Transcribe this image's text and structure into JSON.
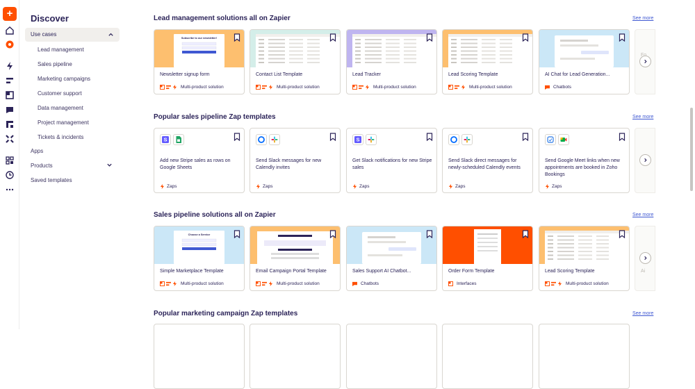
{
  "sidebar": {
    "title": "Discover",
    "use_cases": "Use cases",
    "sub_items": [
      "Lead management",
      "Sales pipeline",
      "Marketing campaigns",
      "Customer support",
      "Data management",
      "Project management",
      "Tickets & incidents"
    ],
    "apps": "Apps",
    "products": "Products",
    "saved": "Saved templates"
  },
  "rail_icons": [
    "create-plus-icon",
    "home-icon",
    "discover-icon",
    "zaps-icon",
    "tables-icon",
    "interfaces-icon",
    "chatbots-icon",
    "canvas-icon",
    "agents-icon",
    "app-connections-icon",
    "history-icon",
    "more-icon"
  ],
  "colors": {
    "brand": "#ff4f00",
    "link": "#3f58d2",
    "ink": "#2b2358"
  },
  "see_more": "See more",
  "sections": [
    {
      "title": "Lead management solutions all on Zapier",
      "cards": [
        {
          "title": "Newsletter signup form",
          "meta": "Multi-product solution",
          "thumb_bg": "#fdbf6f",
          "kind": "form",
          "thumb_text": "Subscribe to our newsletter!"
        },
        {
          "title": "Contact List Template",
          "meta": "Multi-product solution",
          "thumb_bg": "#d4eee9",
          "kind": "table"
        },
        {
          "title": "Lead Tracker",
          "meta": "Multi-product solution",
          "thumb_bg": "#bfb5f0",
          "kind": "table"
        },
        {
          "title": "Lead Scoring Template",
          "meta": "Multi-product solution",
          "thumb_bg": "#fdbf6f",
          "kind": "table"
        },
        {
          "title": "AI Chat for Lead Generation...",
          "meta": "Chatbots",
          "thumb_bg": "#cbe7f7",
          "kind": "chat"
        }
      ]
    },
    {
      "title": "Popular sales pipeline Zap templates",
      "zaps": [
        {
          "title": "Add new Stripe sales as rows on Google Sheets",
          "meta": "Zaps",
          "apps": [
            "stripe-icon",
            "google-sheets-icon"
          ]
        },
        {
          "title": "Send Slack messages for new Calendly invites",
          "meta": "Zaps",
          "apps": [
            "calendly-icon",
            "slack-icon"
          ]
        },
        {
          "title": "Get Slack notifications for new Stripe sales",
          "meta": "Zaps",
          "apps": [
            "stripe-icon",
            "slack-icon"
          ]
        },
        {
          "title": "Send Slack direct messages for newly-scheduled Calendly events",
          "meta": "Zaps",
          "apps": [
            "calendly-icon",
            "slack-icon"
          ]
        },
        {
          "title": "Send Google Meet links when new appointments are booked in Zoho Bookings",
          "meta": "Zaps",
          "apps": [
            "zoho-bookings-icon",
            "google-meet-icon"
          ]
        }
      ]
    },
    {
      "title": "Sales pipeline solutions all on Zapier",
      "cards": [
        {
          "title": "Simple Marketplace Template",
          "meta": "Multi-product solution",
          "thumb_bg": "#cbe7f7",
          "kind": "service",
          "thumb_text": "Choose a Service"
        },
        {
          "title": "Email Campaign Portal Template",
          "meta": "Multi-product solution",
          "thumb_bg": "#fdbf6f",
          "kind": "portal"
        },
        {
          "title": "Sales Support AI Chatbot...",
          "meta": "Chatbots",
          "thumb_bg": "#cbe7f7",
          "kind": "chat"
        },
        {
          "title": "Order Form Template",
          "meta": "Interfaces",
          "thumb_bg": "#ff4f00",
          "kind": "order"
        },
        {
          "title": "Lead Scoring Template",
          "meta": "Multi-product solution",
          "thumb_bg": "#fdbf6f",
          "kind": "table"
        }
      ]
    },
    {
      "title": "Popular marketing campaign Zap templates"
    }
  ],
  "ghost_labels": [
    "Fo",
    "Ai"
  ]
}
